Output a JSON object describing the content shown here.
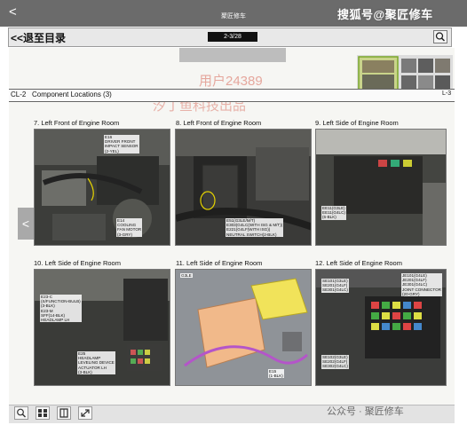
{
  "app": {
    "title": "聚匠修车",
    "back_glyph": "<"
  },
  "watermarks": {
    "sohu": "搜狐号@聚匠修车",
    "user": "用户24389",
    "company": "汐丁鱼科技出品",
    "wechat": "公众号 · 聚匠修车"
  },
  "toolbar": {
    "back_to_toc": "<<退至目录",
    "page_indicator": "2-3/28",
    "search_icon": "search-icon"
  },
  "document": {
    "section_code": "CL-2",
    "section_title": "Component Locations (3)",
    "page_ref": "L-3",
    "panels": [
      {
        "caption": "7. Left Front of Engine Room",
        "labels": [
          "E16\nDRIVER FRONT\nIMPACT SENSOR\n(2-YEL)",
          "E14\nCOOLING\nFAN MOTOR\n(3-GRY)"
        ]
      },
      {
        "caption": "8. Left Front of Engine Room",
        "labels": [
          "E51(G3LE/M/T)\nE303(G4LC(WITH ISG & M/T))\nE221(G4LF(WITH ISG))\nNEUTRAL SWITCH(2-BLK)"
        ]
      },
      {
        "caption": "9. Left Side of Engine Room",
        "labels": [
          "EE11(G3LE)\nEE11(G4LC)\n(6-BLK)"
        ]
      },
      {
        "caption": "10. Left Side of Engine Room",
        "labels": [
          "E23-C\n(S/FUNCTION-BULB)\n(3-BLK)\nE23-M\nSFF(14-BLK)\nHEADLAMP LH",
          "E25\nHEADLAMP\nLEVELING DEVICE\nACTUATOR LH\n(3-BLK)"
        ]
      },
      {
        "caption": "11. Left Side of Engine Room",
        "labels": [
          "G3LE",
          "E15\n(1-BLK)"
        ]
      },
      {
        "caption": "12. Left Side of Engine Room",
        "labels": [
          "JE101(G4LE)\nJE201(G4LF)\nJE301(G4LC)\nJOINT CONNECTOR\n(20-GRY)",
          "SE101(G3LE)\nSE201(G4LF)\nSE301(G4LC)",
          "SE102(G3LE)\nSE202(G4LF)\nSE302(G4LC)"
        ]
      }
    ]
  },
  "nav": {
    "prev_glyph": "<"
  },
  "bottom_bar": {
    "buttons": [
      "zoom-icon",
      "grid-icon",
      "book-icon",
      "expand-icon"
    ]
  },
  "colors": {
    "topbar": "#6b6b6b",
    "watermark": "#e39a8f",
    "highlight_battery": "#f1b98a",
    "highlight_fusebox": "#f1e35a"
  }
}
